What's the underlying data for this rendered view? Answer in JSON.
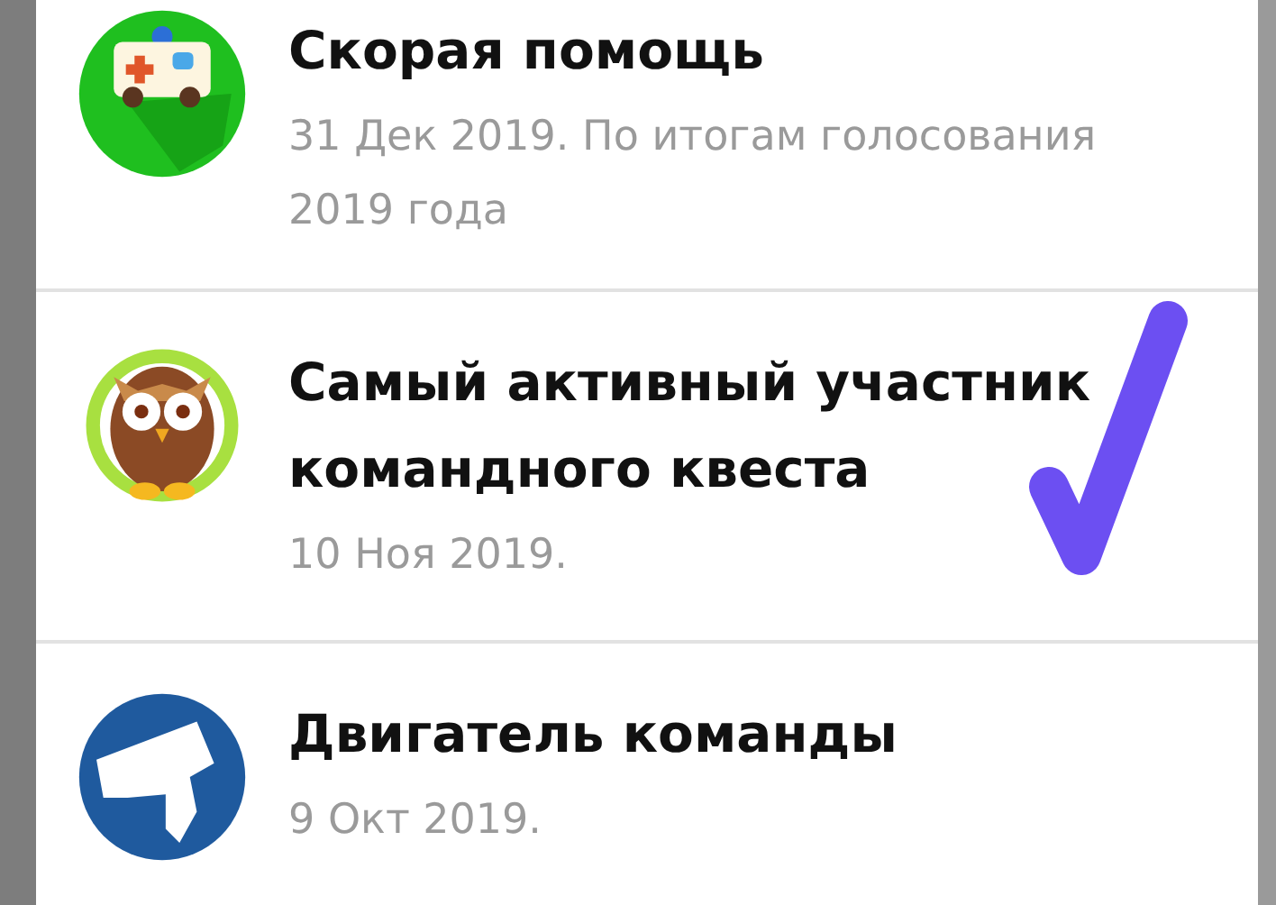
{
  "achievements": [
    {
      "title": "Скорая помощь",
      "subtitle": "31 Дек 2019. По итогам голосования 2019 года"
    },
    {
      "title": "Самый активный участник командного квеста",
      "subtitle": "10 Ноя 2019."
    },
    {
      "title": "Двигатель команды",
      "subtitle": "9 Окт 2019."
    }
  ]
}
